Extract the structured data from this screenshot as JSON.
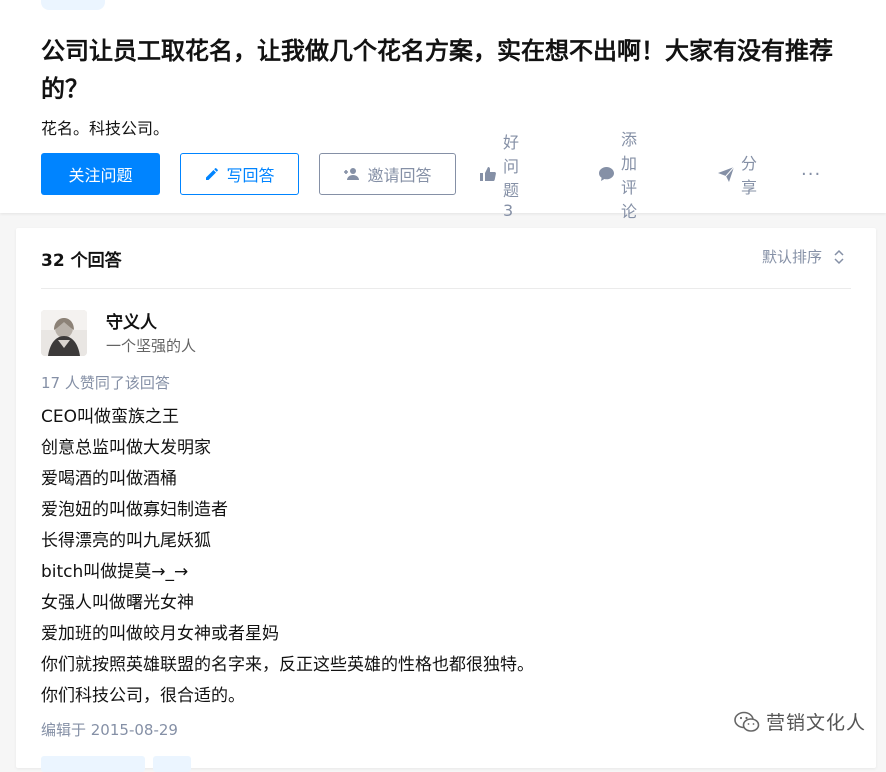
{
  "question": {
    "title": "公司让员工取花名，让我做几个花名方案，实在想不出啊！大家有没有推荐的？",
    "detail": "花名。科技公司。",
    "actions": {
      "follow": "关注问题",
      "write": "写回答",
      "invite": "邀请回答",
      "good": "好问题 3",
      "comment": "添加评论",
      "share": "分享",
      "more": "···"
    }
  },
  "answers": {
    "count_label": "32 个回答",
    "sort_label": "默认排序",
    "item": {
      "author": {
        "name": "守义人",
        "bio": "一个坚强的人"
      },
      "votes": "17 人赞同了该回答",
      "lines": [
        "CEO叫做蛮族之王",
        "创意总监叫做大发明家",
        "爱喝酒的叫做酒桶",
        "爱泡妞的叫做寡妇制造者",
        "长得漂亮的叫九尾妖狐",
        "bitch叫做提莫→_→",
        "女强人叫做曙光女神",
        "爱加班的叫做皎月女神或者星妈",
        "你们就按照英雄联盟的名字来，反正这些英雄的性格也都很独特。",
        "你们科技公司，很合适的。"
      ],
      "edited": "编辑于 2015-08-29"
    }
  },
  "watermark": {
    "text": "营销文化人",
    "icon": "wechat-icon"
  },
  "colors": {
    "primary": "#0084ff",
    "muted": "#8590a6",
    "text": "#121212",
    "background": "#f6f6f6"
  }
}
